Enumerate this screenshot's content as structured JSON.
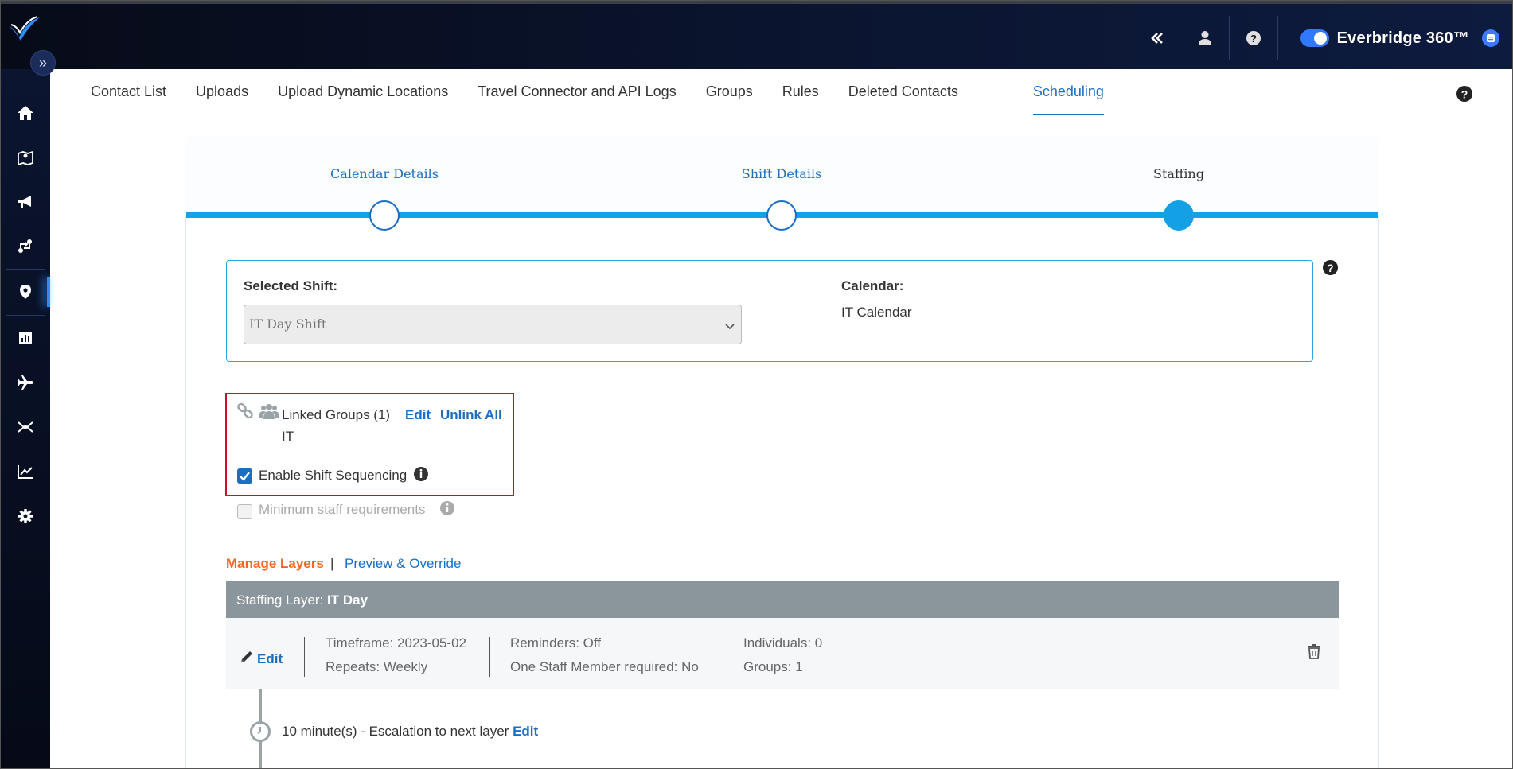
{
  "header": {
    "brand": "Everbridge 360™",
    "icons": [
      "collapse-icon",
      "user-icon",
      "help-icon",
      "chat-icon"
    ]
  },
  "sidebar": {
    "items": [
      "home-icon",
      "map-icon",
      "megaphone-icon",
      "incident-icon",
      "location-icon",
      "report-icon",
      "plane-icon",
      "routing-icon",
      "chart-icon",
      "gear-icon"
    ],
    "active": "location-icon"
  },
  "tabs": [
    {
      "label": "Contact List"
    },
    {
      "label": "Uploads"
    },
    {
      "label": "Upload Dynamic Locations"
    },
    {
      "label": "Travel Connector and API Logs"
    },
    {
      "label": "Groups"
    },
    {
      "label": "Rules"
    },
    {
      "label": "Deleted Contacts"
    },
    {
      "label": "Scheduling"
    }
  ],
  "active_tab": "Scheduling",
  "stepper": {
    "steps": [
      {
        "label": "Calendar Details"
      },
      {
        "label": "Shift Details"
      },
      {
        "label": "Staffing"
      }
    ],
    "current": "Staffing"
  },
  "shift": {
    "selected_label": "Selected Shift:",
    "selected_value": "IT Day Shift",
    "calendar_label": "Calendar:",
    "calendar_value": "IT Calendar"
  },
  "linked_groups": {
    "label": "Linked Groups (1)",
    "edit": "Edit",
    "unlink": "Unlink All",
    "group": "IT",
    "enable_sequencing": "Enable Shift Sequencing",
    "enable_sequencing_checked": true,
    "min_staff": "Minimum staff requirements",
    "min_staff_checked": false
  },
  "manage": {
    "manage_layers": "Manage Layers",
    "separator": "|",
    "preview": "Preview & Override"
  },
  "layer": {
    "head_prefix": "Staffing Layer: ",
    "head_name": "IT Day",
    "edit": "Edit",
    "timeframe": "Timeframe: 2023-05-02",
    "repeats": "Repeats: Weekly",
    "reminders": "Reminders: Off",
    "one_staff": "One Staff Member required: No",
    "individuals": "Individuals: 0",
    "groups": "Groups: 1"
  },
  "escalation": {
    "text": "10 minute(s) - Escalation to next layer ",
    "edit": "Edit"
  },
  "colors": {
    "accent": "#1a6fc4",
    "orange": "#f26522",
    "highlight": "#c8102e",
    "step": "#14a0e5"
  }
}
